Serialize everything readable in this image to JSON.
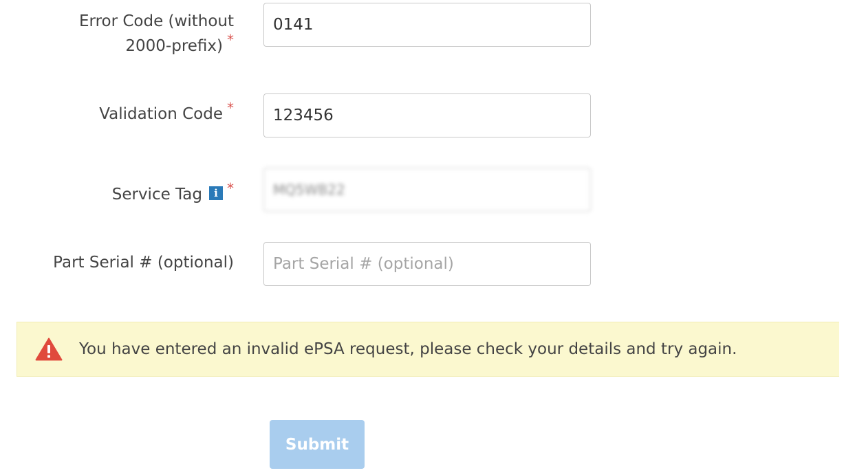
{
  "form": {
    "error_code": {
      "label_line1": "Error Code (without",
      "label_line2": "2000-prefix)",
      "required_mark": "*",
      "value": "0141"
    },
    "validation_code": {
      "label": "Validation Code",
      "required_mark": "*",
      "value": "123456"
    },
    "service_tag": {
      "label": "Service Tag",
      "info_icon_glyph": "i",
      "required_mark": "*",
      "value": "MQ5WB22"
    },
    "part_serial": {
      "label": "Part Serial # (optional)",
      "placeholder": "Part Serial # (optional)",
      "value": ""
    }
  },
  "alert": {
    "icon": "warning-triangle-icon",
    "message": "You have entered an invalid ePSA request, please check your details and try again."
  },
  "submit": {
    "label": "Submit",
    "state": "disabled"
  },
  "colors": {
    "required": "#d9534f",
    "info_icon": "#2a7ab8",
    "alert_bg": "#fbf8cf",
    "warning_icon": "#e04a3c",
    "submit_disabled": "#a9cdee"
  }
}
